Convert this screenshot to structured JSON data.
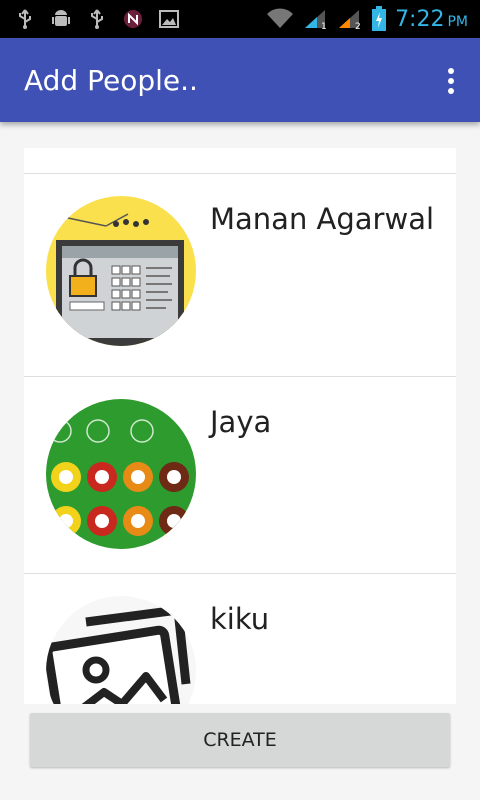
{
  "status_bar": {
    "time": "7:22",
    "ampm": "PM",
    "left_icons": [
      "usb-icon",
      "android-debug-icon",
      "usb-icon",
      "notification-n-icon",
      "image-icon"
    ],
    "right_icons": [
      "wifi-icon",
      "signal-sim1-icon",
      "signal-sim2-icon",
      "battery-charging-icon"
    ],
    "clock_color": "#33b5e5"
  },
  "app_bar": {
    "title": "Add People..",
    "color": "#3f51b5",
    "menu_icon": "overflow-menu-icon"
  },
  "people": [
    {
      "name": "Manan Agarwal",
      "avatar": "lockbox-puzzle-avatar"
    },
    {
      "name": "Jaya",
      "avatar": "billiard-balls-avatar"
    },
    {
      "name": "kiku",
      "avatar": "image-placeholder-avatar"
    }
  ],
  "create_button": {
    "label": "CREATE"
  }
}
